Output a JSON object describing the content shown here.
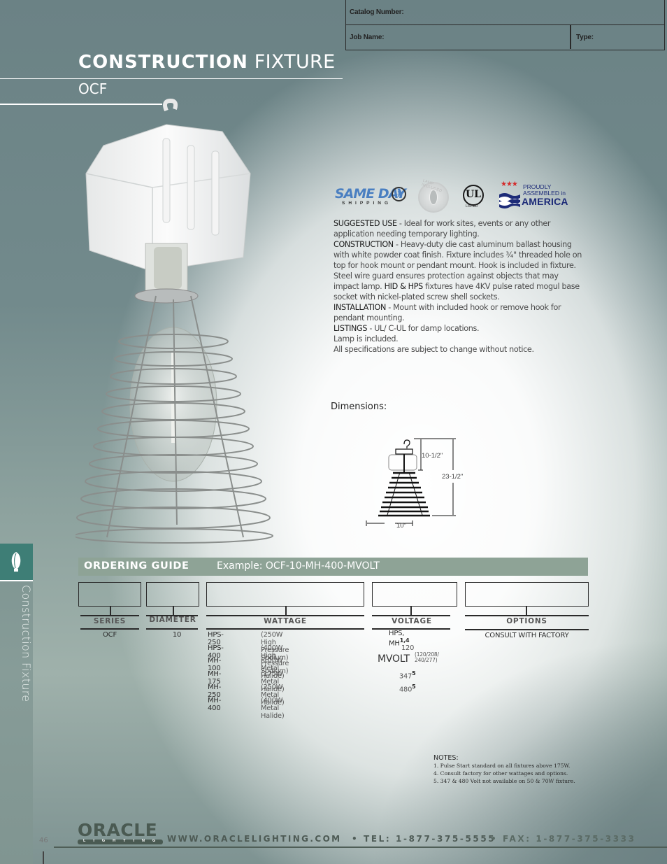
{
  "form": {
    "catalog_label": "Catalog Number:",
    "job_label": "Job Name:",
    "type_label": "Type:"
  },
  "header": {
    "title_bold": "CONSTRUCTION",
    "title_light": "FIXTURE",
    "subtitle": "OCF"
  },
  "badges": {
    "same_day": "SAME DAY",
    "shipping": "SHIPPING",
    "lamp_included": "LAMP INCLUDED",
    "ul": "UL",
    "ul_listed": "LISTED",
    "proudly": "PROUDLY",
    "assembled": "ASSEMBLED in",
    "america": "AMERICA"
  },
  "description": {
    "suggested_use_label": "SUGGESTED USE",
    "suggested_use_text": " - Ideal for work sites, events or any other application needing temporary lighting.",
    "construction_label": "CONSTRUCTION",
    "construction_text": " - Heavy-duty die cast aluminum ballast housing with white powder coat finish. Fixture includes ¾\" threaded hole on top for hook mount or pendant mount. Hook is included in fixture. Steel wire guard ensures protection against objects that may impact lamp. ",
    "hid_hps_label": "HID & HPS",
    "hid_hps_text": " fixtures have 4KV pulse rated mogul base socket with nickel-plated screw shell sockets.",
    "installation_label": "INSTALLATION",
    "installation_text": " - Mount with included hook or remove hook for pendant mounting.",
    "listings_label": "LISTINGS",
    "listings_text": " - UL/ C-UL for damp locations.",
    "lamp_note": "Lamp is included.",
    "disclaimer": "All specifications are subject to change without notice."
  },
  "dimensions": {
    "label": "Dimensions:",
    "housing_height": "10-1/2\"",
    "overall_height": "23-1/2\"",
    "width": "10\""
  },
  "sidebar": {
    "section_label": "Construction Fixture"
  },
  "ordering_guide": {
    "title": "ORDERING GUIDE",
    "example": "Example: OCF-10-MH-400-MVOLT",
    "columns": {
      "series": "SERIES",
      "diameter": "DIAMETER",
      "wattage": "WATTAGE",
      "voltage": "VOLTAGE",
      "options": "OPTIONS"
    },
    "series_values": [
      "OCF"
    ],
    "diameter_values": [
      "10"
    ],
    "wattage_rows": [
      {
        "code": "HPS-250",
        "desc": "(250W High Pressure Sodium)"
      },
      {
        "code": "HPS-400",
        "desc": "(400W High Pressure Sodium)"
      },
      {
        "code": "MH-100",
        "desc": "(100W Metal Halide)"
      },
      {
        "code": "MH-175",
        "desc": "(175W Metal Halide)"
      },
      {
        "code": "MH-250",
        "desc": "(250W Metal Halide)"
      },
      {
        "code": "MH-400",
        "desc": "(400W Metal Halide)"
      }
    ],
    "voltage": {
      "header_note": "HPS, MH",
      "header_sup": "1,4",
      "v120": "120",
      "mvolt": "MVOLT",
      "mvolt_range_1": "(120/208/",
      "mvolt_range_2": "240/277)",
      "v347": "347",
      "v347_sup": "5",
      "v480": "480",
      "v480_sup": "5"
    },
    "options_values": [
      "CONSULT WITH FACTORY"
    ]
  },
  "notes": {
    "title": "NOTES:",
    "items": [
      "1. Pulse Start standard on all fixtures above 175W.",
      "4. Consult factory for other wattages and options.",
      "5.  347 & 480 Volt not available on 50 & 70W fixture."
    ]
  },
  "footer": {
    "page_number": "46",
    "logo_word": "ORACLE",
    "logo_sub": "LIGHTING",
    "url": "WWW.ORACLELIGHTING.COM",
    "tel": "• TEL: 1-877-375-5555",
    "fax": "• FAX: 1-877-375-3333"
  },
  "colors": {
    "accent_teal": "#3e7e76",
    "bar_green": "#8ea396",
    "page_slate": "#6b8285"
  }
}
